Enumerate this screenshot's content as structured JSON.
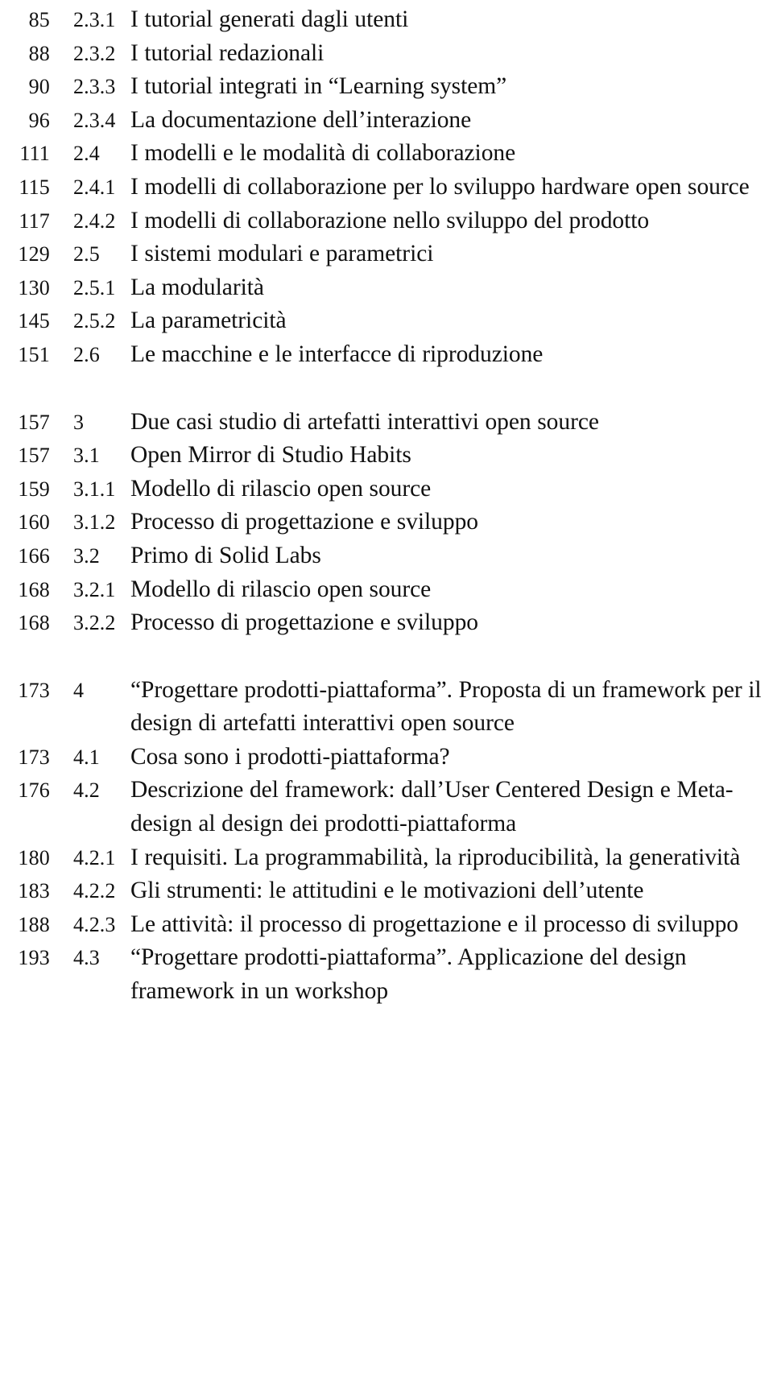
{
  "document": {
    "type": "table-of-contents",
    "language": "it",
    "background_color": "#ffffff",
    "text_color": "#111111"
  },
  "entries": [
    {
      "page": "85",
      "number": "2.3.1",
      "title": "I tutorial generati dagli utenti",
      "gap_before": false
    },
    {
      "page": "88",
      "number": "2.3.2",
      "title": "I tutorial redazionali",
      "gap_before": false
    },
    {
      "page": "90",
      "number": "2.3.3",
      "title": "I tutorial integrati in “Learning system”",
      "gap_before": false
    },
    {
      "page": "96",
      "number": "2.3.4",
      "title": "La documentazione dell’interazione",
      "gap_before": false
    },
    {
      "page": "111",
      "number": "2.4",
      "title": "I modelli e le modalità di collaborazione",
      "gap_before": false
    },
    {
      "page": "115",
      "number": "2.4.1",
      "title": "I modelli di collaborazione per lo sviluppo hardware open source",
      "gap_before": false
    },
    {
      "page": "117",
      "number": "2.4.2",
      "title": "I modelli di collaborazione nello sviluppo del prodotto",
      "gap_before": false
    },
    {
      "page": "129",
      "number": "2.5",
      "title": "I sistemi modulari e parametrici",
      "gap_before": false
    },
    {
      "page": "130",
      "number": "2.5.1",
      "title": "La modularità",
      "gap_before": false
    },
    {
      "page": "145",
      "number": "2.5.2",
      "title": "La parametricità",
      "gap_before": false
    },
    {
      "page": "151",
      "number": "2.6",
      "title": "Le macchine e le interfacce di riproduzione",
      "gap_before": false
    },
    {
      "page": "157",
      "number": "3",
      "title": "Due casi studio di artefatti interattivi open source",
      "gap_before": true
    },
    {
      "page": "157",
      "number": "3.1",
      "title": "Open Mirror di Studio Habits",
      "gap_before": false
    },
    {
      "page": "159",
      "number": "3.1.1",
      "title": "Modello di rilascio open source",
      "gap_before": false
    },
    {
      "page": "160",
      "number": "3.1.2",
      "title": "Processo di progettazione e sviluppo",
      "gap_before": false
    },
    {
      "page": "166",
      "number": "3.2",
      "title": "Primo di Solid Labs",
      "gap_before": false
    },
    {
      "page": "168",
      "number": "3.2.1",
      "title": "Modello di rilascio open source",
      "gap_before": false
    },
    {
      "page": "168",
      "number": "3.2.2",
      "title": "Processo di progettazione e sviluppo",
      "gap_before": false
    },
    {
      "page": "173",
      "number": "4",
      "title": "“Progettare prodotti-piattaforma”. Proposta di un framework per il design di artefatti interattivi open source",
      "gap_before": true
    },
    {
      "page": "173",
      "number": "4.1",
      "title": "Cosa sono i prodotti-piattaforma?",
      "gap_before": false
    },
    {
      "page": "176",
      "number": "4.2",
      "title": "Descrizione del framework: dall’User Centered Design e Meta-design al design dei prodotti-piattaforma",
      "gap_before": false
    },
    {
      "page": "180",
      "number": "4.2.1",
      "title": "I requisiti. La programmabilità, la riproducibilità, la generatività",
      "gap_before": false
    },
    {
      "page": "183",
      "number": "4.2.2",
      "title": "Gli strumenti: le attitudini e le motivazioni dell’utente",
      "gap_before": false
    },
    {
      "page": "188",
      "number": "4.2.3",
      "title": "Le attività: il processo di progettazione e il processo di sviluppo",
      "gap_before": false
    },
    {
      "page": "193",
      "number": "4.3",
      "title": "“Progettare prodotti-piattaforma”. Applicazione del design framework in un workshop",
      "gap_before": false
    }
  ]
}
